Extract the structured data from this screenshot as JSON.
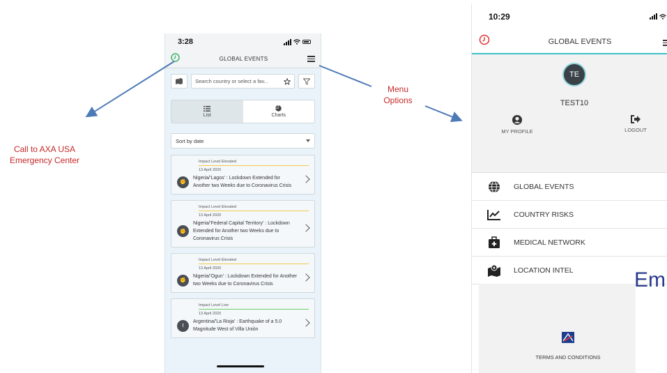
{
  "annotations": {
    "left_label": "Call to AXA USA Emergency Center",
    "menu_label": "Menu Options",
    "color_red": "#c62828",
    "arrow_color": "#4d7ab6"
  },
  "phone_list": {
    "time": "3:28",
    "title": "GLOBAL EVENTS",
    "search_placeholder": "Search country or select a fav...",
    "tabs": {
      "list": "List",
      "charts": "Charts"
    },
    "sort_label": "Sort by date",
    "events": [
      {
        "level": "Impact Level Elevated",
        "date": "13 April 2020",
        "text": "Nigeria/'Lagos' : Lockdown Extended for Another two Weeks due to Coronavirus Crisis",
        "icon": "unrest-icon"
      },
      {
        "level": "Impact Level Elevated",
        "date": "13 April 2020",
        "text": "Nigeria/'Federal Capital Territory' : Lockdown Extended for Another two Weeks due to Coronavirus Crisis",
        "icon": "unrest-icon"
      },
      {
        "level": "Impact Level Elevated",
        "date": "13 April 2020",
        "text": "Nigeria/'Ogun' : Lockdown Extended for Another two Weeks due to Coronavirus Crisis",
        "icon": "unrest-icon"
      },
      {
        "level": "Impact Level Low",
        "date": "13 April 2020",
        "text": "Argentina/'La Rioja' : Earthquake of a 5.0 Magnitude West of Villa Unión",
        "icon": "alert-icon"
      }
    ]
  },
  "phone_menu": {
    "time": "10:29",
    "title": "GLOBAL EVENTS",
    "avatar_initials": "TE",
    "username": "TEST10",
    "my_profile": "MY PROFILE",
    "logout": "LOGOUT",
    "menu_items": [
      {
        "label": "GLOBAL EVENTS",
        "icon": "globe-icon"
      },
      {
        "label": "COUNTRY RISKS",
        "icon": "chart-line-icon"
      },
      {
        "label": "MEDICAL NETWORK",
        "icon": "medical-kit-icon"
      },
      {
        "label": "LOCATION INTEL",
        "icon": "map-pin-icon"
      }
    ],
    "terms": "TERMS AND CONDITIONS",
    "accent_color": "#3ec0c7"
  },
  "background_text": {
    "emergency_fragment": "Em"
  }
}
